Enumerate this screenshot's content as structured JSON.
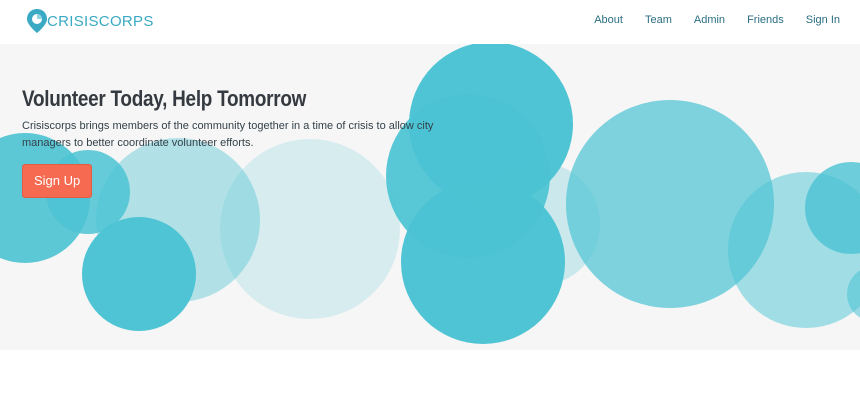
{
  "brand": {
    "name": "CRISISCORPS",
    "logo_icon": "location-pin-icon",
    "accent_color": "#3aa9c4"
  },
  "nav": {
    "items": [
      {
        "label": "About"
      },
      {
        "label": "Team"
      },
      {
        "label": "Admin"
      },
      {
        "label": "Friends"
      },
      {
        "label": "Sign In"
      }
    ]
  },
  "hero": {
    "title": "Volunteer Today, Help Tomorrow",
    "description": "Crisiscorps brings members of the community together in a time of crisis to allow city managers to better coordinate volunteer efforts.",
    "signup_label": "Sign Up",
    "button_color": "#f56a50",
    "background_color": "#f6f6f6",
    "bubble_color": "#4bc3d3"
  }
}
